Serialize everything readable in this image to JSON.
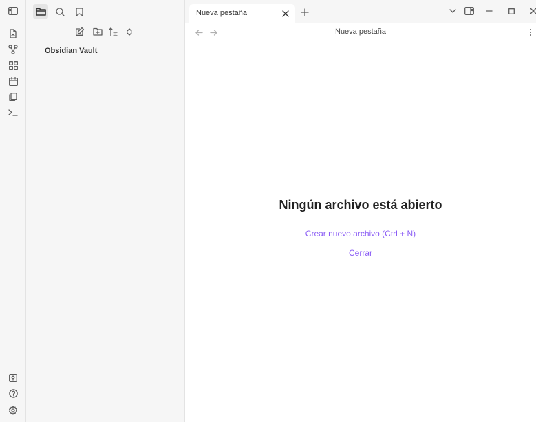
{
  "ribbon": {
    "top_icons": [
      "sidebar-toggle-icon",
      "open-quick-switcher-icon",
      "graph-view-icon",
      "canvas-icon",
      "daily-note-icon",
      "templates-icon",
      "command-palette-icon"
    ],
    "bottom_icons": [
      "vault-switcher-icon",
      "help-icon",
      "settings-icon"
    ]
  },
  "sidebar": {
    "tabs": [
      "files-tab",
      "search-tab",
      "bookmarks-tab"
    ],
    "nav_actions": [
      "new-note",
      "new-folder",
      "sort",
      "collapse-all"
    ],
    "vault_name": "Obsidian Vault"
  },
  "tabbar": {
    "tab_title": "Nueva pestaña",
    "close_symbol": "×",
    "new_tab_symbol": "+"
  },
  "view": {
    "title": "Nueva pestaña",
    "empty_title": "Ningún archivo está abierto",
    "create_link": "Crear nuevo archivo (Ctrl + N)",
    "close_link": "Cerrar"
  },
  "colors": {
    "accent": "#8a5cf5",
    "sidebar_bg": "#f6f6f6",
    "main_bg": "#ffffff"
  }
}
